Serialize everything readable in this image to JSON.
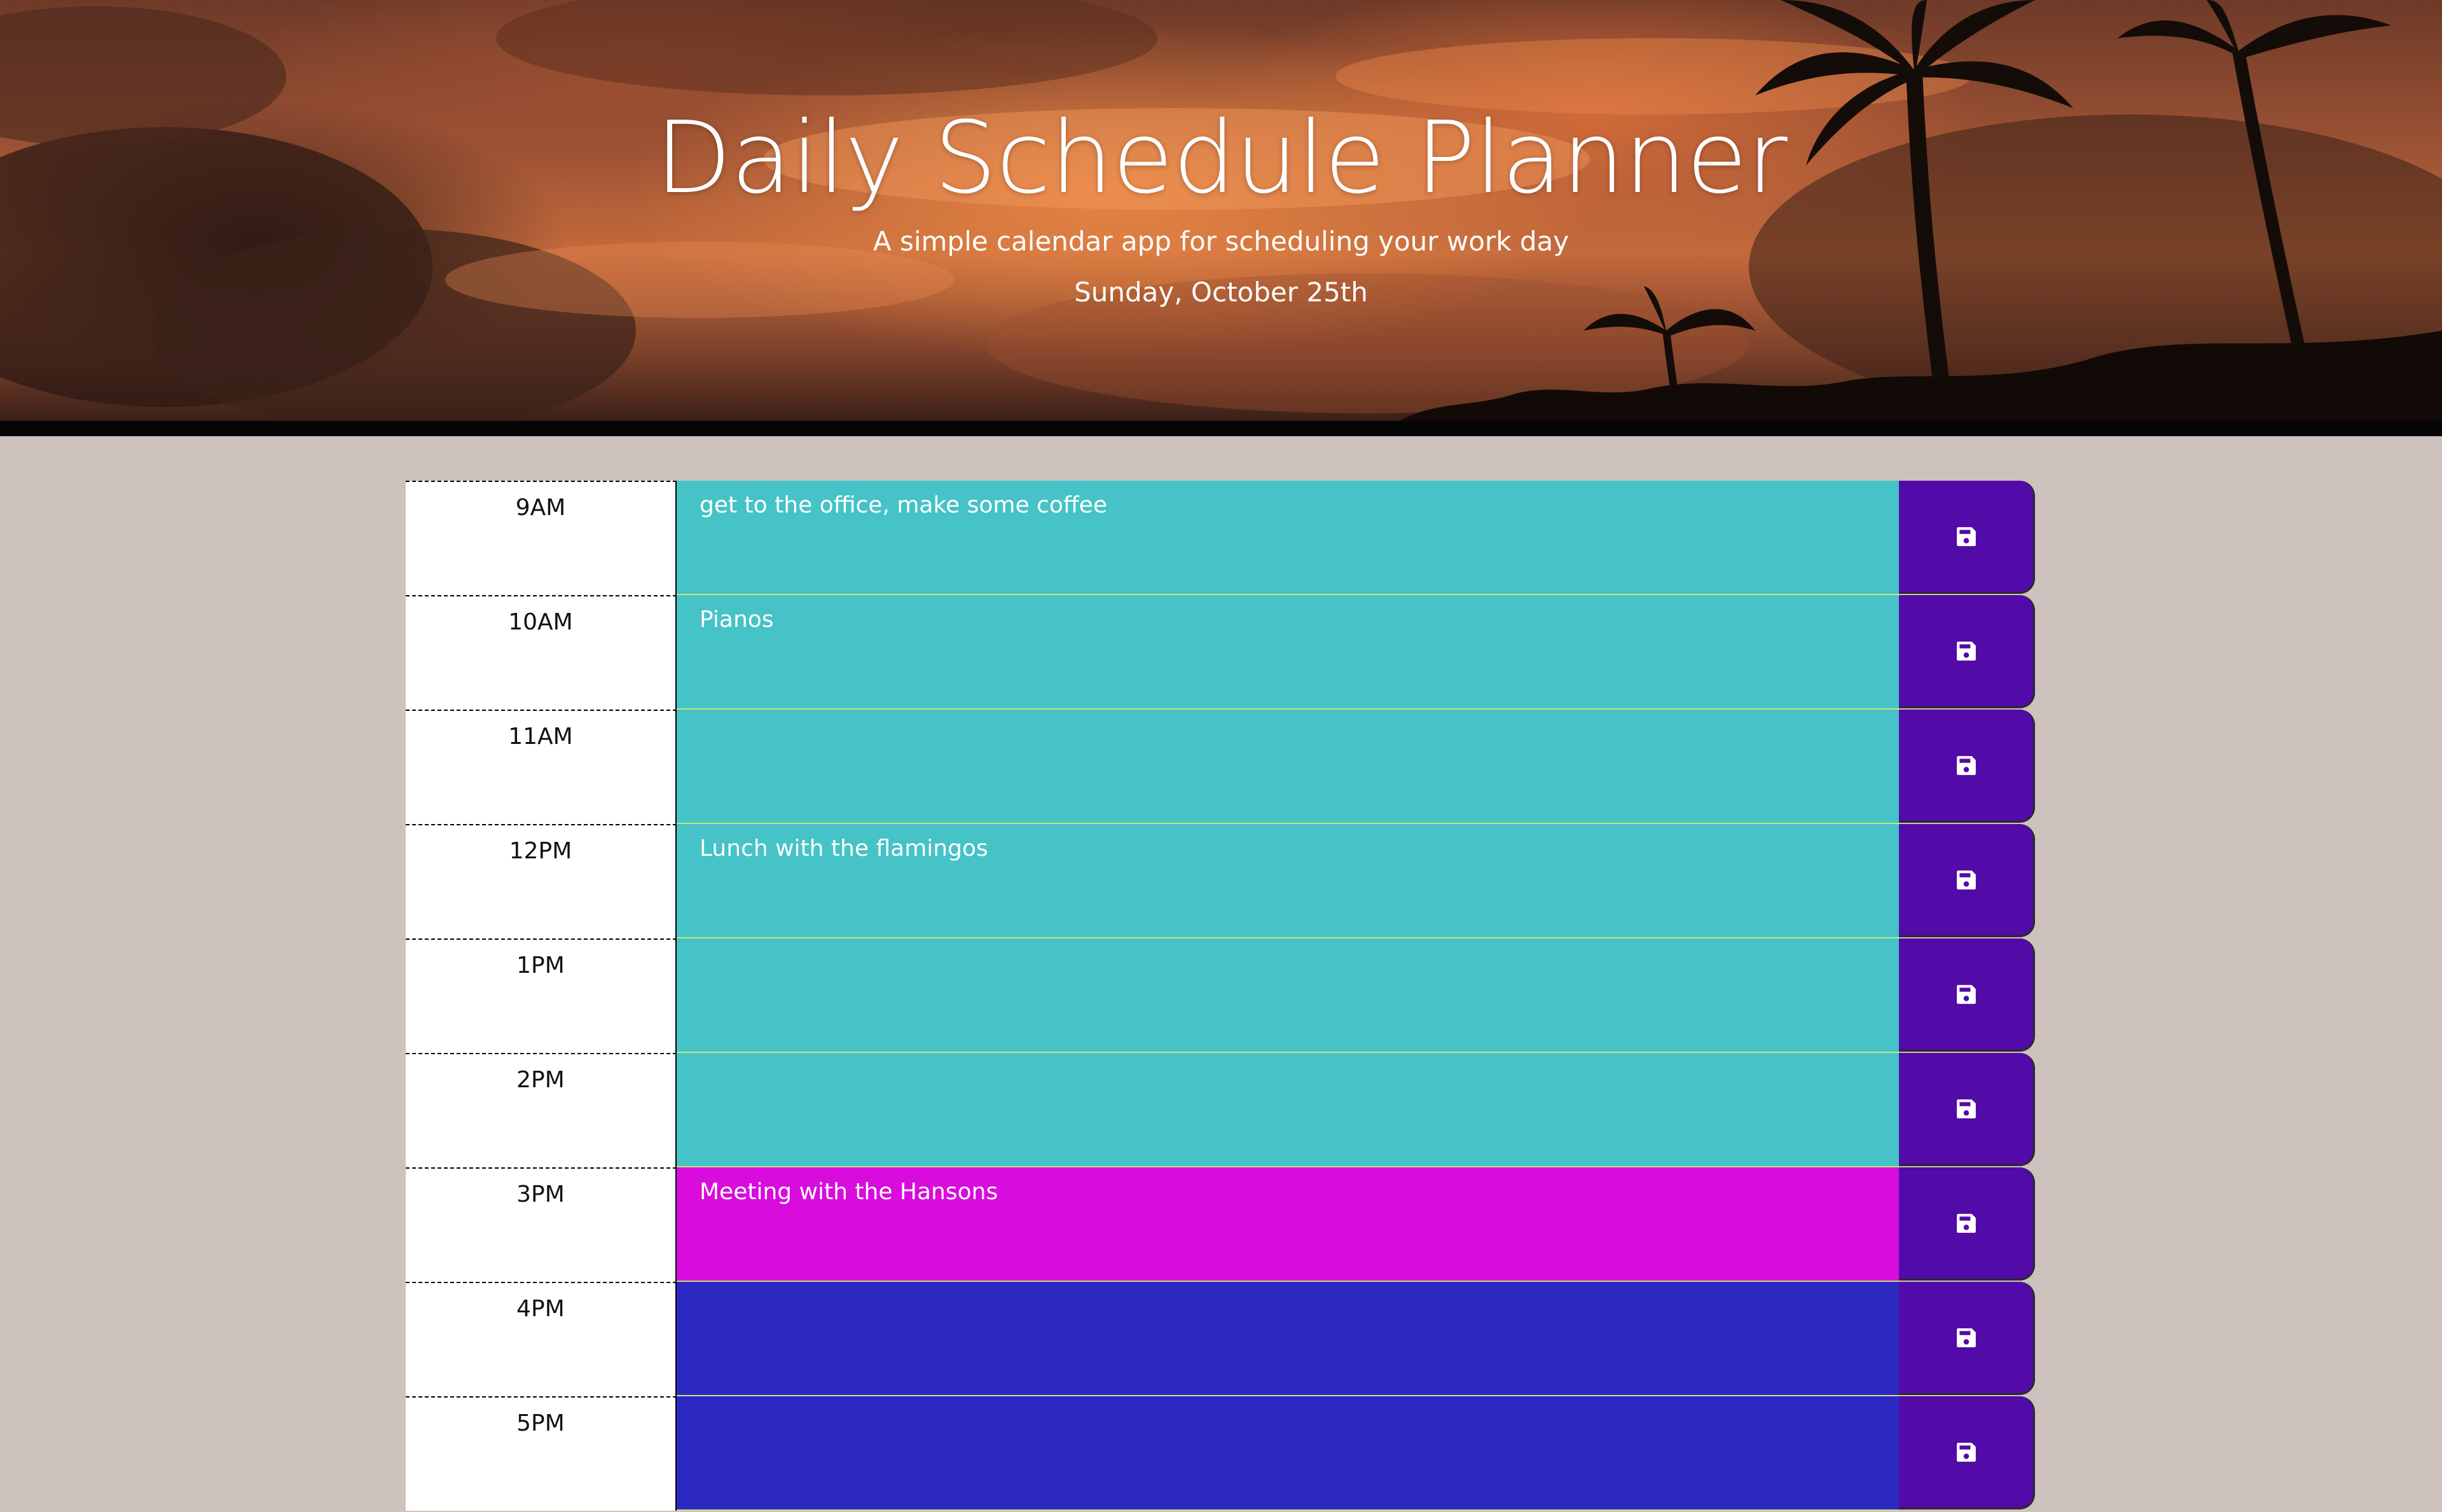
{
  "header": {
    "title": "Daily Schedule Planner",
    "subtitle": "A simple calendar app for scheduling your work day",
    "current_date": "Sunday, October 25th"
  },
  "colors": {
    "past": "#45c3c6",
    "present": "#d80cdc",
    "future": "#2c29c2",
    "save_button": "#520aa8",
    "page_background": "#cec2be"
  },
  "schedule": {
    "rows": [
      {
        "hour": "9AM",
        "task": "get to the office, make some coffee",
        "state": "past",
        "save_icon": "floppy-disk-icon"
      },
      {
        "hour": "10AM",
        "task": "Pianos",
        "state": "past",
        "save_icon": "floppy-disk-icon"
      },
      {
        "hour": "11AM",
        "task": "",
        "state": "past",
        "save_icon": "floppy-disk-icon"
      },
      {
        "hour": "12PM",
        "task": "Lunch with the flamingos",
        "state": "past",
        "save_icon": "floppy-disk-icon"
      },
      {
        "hour": "1PM",
        "task": "",
        "state": "past",
        "save_icon": "floppy-disk-icon"
      },
      {
        "hour": "2PM",
        "task": "",
        "state": "past",
        "save_icon": "floppy-disk-icon"
      },
      {
        "hour": "3PM",
        "task": "Meeting with the Hansons",
        "state": "present",
        "save_icon": "floppy-disk-icon"
      },
      {
        "hour": "4PM",
        "task": "",
        "state": "future",
        "save_icon": "floppy-disk-icon"
      },
      {
        "hour": "5PM",
        "task": "",
        "state": "future",
        "save_icon": "floppy-disk-icon"
      }
    ]
  }
}
